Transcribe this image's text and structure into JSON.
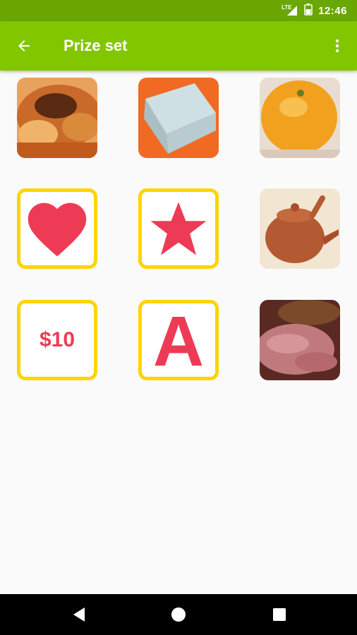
{
  "status_bar": {
    "time": "12:46",
    "network": "LTE"
  },
  "app_bar": {
    "title": "Prize set"
  },
  "prizes": [
    {
      "type": "photo",
      "icon": "roast-chicken-photo"
    },
    {
      "type": "photo",
      "icon": "gift-box-photo"
    },
    {
      "type": "photo",
      "icon": "orange-fruit-photo"
    },
    {
      "type": "icon",
      "icon": "heart-icon"
    },
    {
      "type": "icon",
      "icon": "star-icon"
    },
    {
      "type": "photo",
      "icon": "teapot-photo"
    },
    {
      "type": "text",
      "label": "$10"
    },
    {
      "type": "text",
      "label": "A"
    },
    {
      "type": "photo",
      "icon": "sliced-meat-photo"
    }
  ],
  "colors": {
    "app_bar": "#82c600",
    "status_bar": "#6aa703",
    "tile_border": "#ffd400",
    "accent": "#ee3b55"
  }
}
